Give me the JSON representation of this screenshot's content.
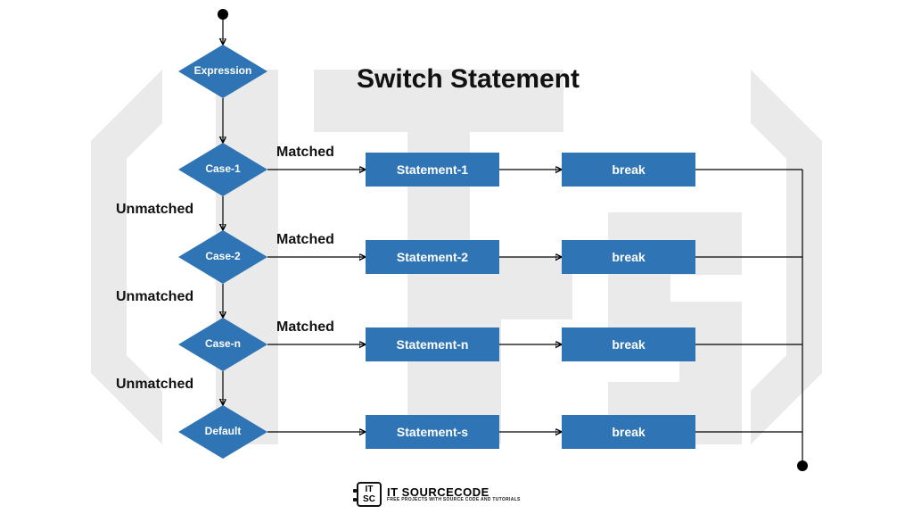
{
  "title": "Switch Statement",
  "nodes": {
    "expression": "Expression",
    "case1": "Case-1",
    "case2": "Case-2",
    "casen": "Case-n",
    "default": "Default",
    "stmt1": "Statement-1",
    "stmt2": "Statement-2",
    "stmtn": "Statement-n",
    "stmts": "Statement-s",
    "break1": "break",
    "break2": "break",
    "breakn": "break",
    "breaks": "break"
  },
  "labels": {
    "matched": "Matched",
    "unmatched": "Unmatched"
  },
  "attribution": {
    "logo_text": "IT\nSC",
    "main": "IT SOURCECODE",
    "sub": "FREE PROJECTS WITH SOURCE CODE AND TUTORIALS"
  },
  "colors": {
    "node_fill": "#2f74b5",
    "node_text": "#ffffff",
    "line": "#000000"
  }
}
